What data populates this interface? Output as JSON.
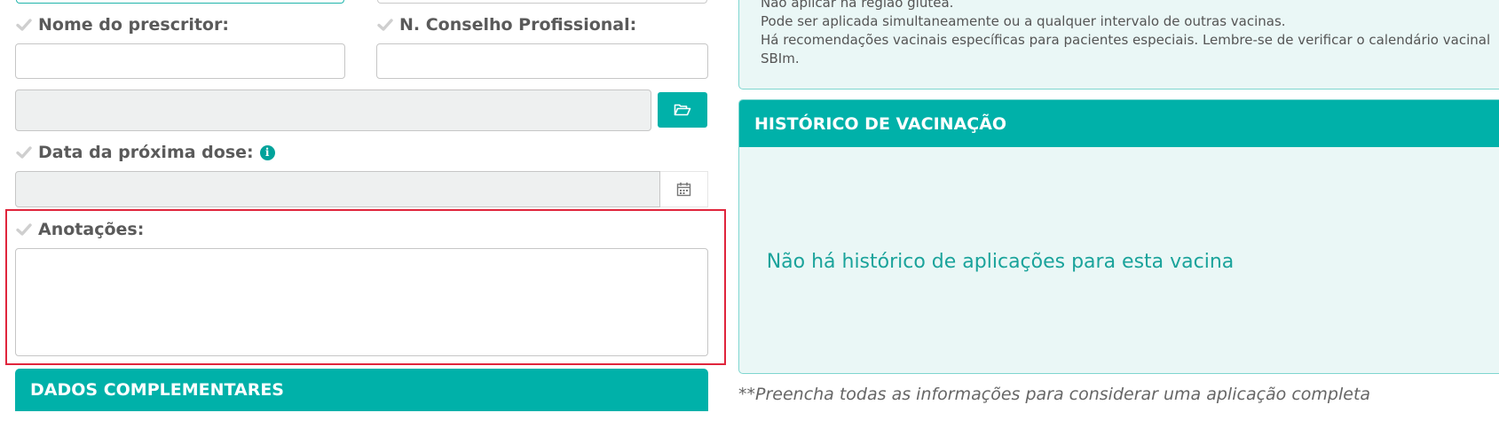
{
  "form": {
    "prescriber_label": "Nome do prescritor:",
    "prescriber_value": "",
    "council_label": "N. Conselho Profissional:",
    "council_value": "",
    "file_value": "",
    "next_dose_label": "Data da próxima dose:",
    "next_dose_value": "",
    "notes_label": "Anotações:",
    "notes_value": "",
    "complementary_title": "DADOS COMPLEMENTARES"
  },
  "info": {
    "lines": [
      "Não aplicar na região glútea.",
      "Pode ser aplicada simultaneamente ou a qualquer intervalo de outras vacinas.",
      "Há recomendações vacinais específicas para pacientes especiais. Lembre-se de verificar o calendário vacinal",
      "SBIm."
    ]
  },
  "history": {
    "title": "HISTÓRICO DE VACINAÇÃO",
    "empty_message": "Não há histórico de aplicações para esta vacina"
  },
  "footnote": "**Preencha todas as informações para considerar uma aplicação completa",
  "icons": {
    "check": "check-icon",
    "folder": "folder-open-icon",
    "calendar": "calendar-icon",
    "info": "info-icon"
  },
  "colors": {
    "accent": "#00b1a9",
    "highlight": "#e0253c",
    "panel_bg": "#eaf7f6"
  }
}
